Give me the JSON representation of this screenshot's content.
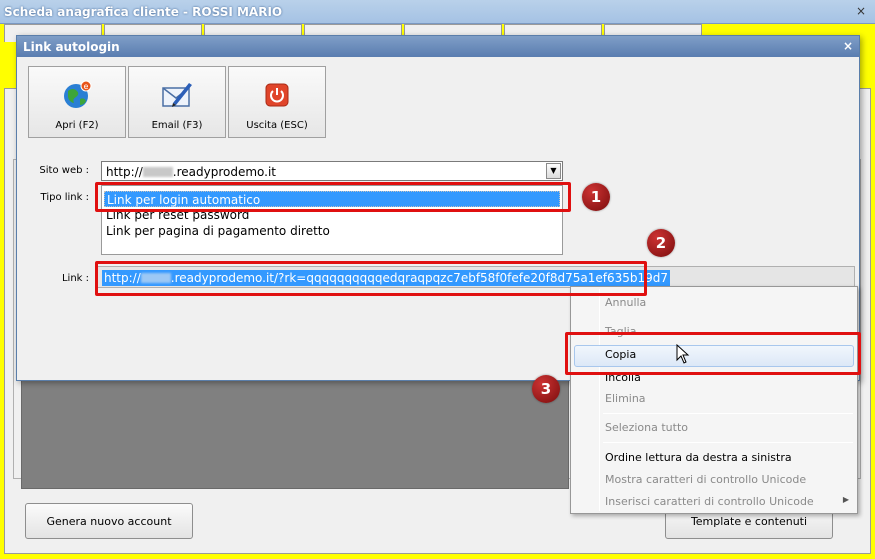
{
  "parent_window": {
    "title": "Scheda anagrafica cliente - ROSSI MARIO",
    "buttons": {
      "new_account": "Genera nuovo account",
      "templates": "Template e contenuti"
    }
  },
  "dialog": {
    "title": "Link autologin",
    "close": "×",
    "toolbar": {
      "open": "Apri (F2)",
      "email": "Email (F3)",
      "exit": "Uscita (ESC)"
    },
    "website": {
      "label": "Sito web :",
      "value_prefix": "http://",
      "value_suffix": ".readyprodemo.it",
      "dropdown_arrow": "▼"
    },
    "link_type": {
      "label": "Tipo link :",
      "options": [
        "Link per login automatico",
        "Link per reset password",
        "Link per pagina di pagamento diretto"
      ],
      "selected_index": 0
    },
    "link": {
      "label": "Link :",
      "value_prefix": "http://",
      "value_suffix": ".readyprodemo.it/?rk=qqqqqqqqqqedqraqpqzc7ebf58f0fefe20f8d75a1ef635b19d7"
    }
  },
  "context_menu": {
    "items": [
      {
        "label": "Annulla",
        "enabled": false
      },
      {
        "label": "Taglia",
        "enabled": false
      },
      {
        "label": "Copia",
        "enabled": true,
        "hover": true
      },
      {
        "label": "Incolla",
        "enabled": true
      },
      {
        "label": "Elimina",
        "enabled": false
      },
      {
        "label": "Seleziona tutto",
        "enabled": false
      },
      {
        "label": "Ordine lettura da destra a sinistra",
        "enabled": true
      },
      {
        "label": "Mostra caratteri di controllo Unicode",
        "enabled": false
      },
      {
        "label": "Inserisci caratteri di controllo Unicode",
        "enabled": false,
        "submenu": true
      }
    ],
    "submenu_arrow": "▶"
  },
  "annotations": {
    "step1": "1",
    "step2": "2",
    "step3": "3",
    "highlight_color": "#e01010",
    "badge_color": "#8b1010"
  },
  "colors": {
    "selection": "#3399ff",
    "background": "#ffff00",
    "dialog_title": "#5a7db0"
  },
  "icons": {
    "open": "globe-icon",
    "email": "envelope-pen-icon",
    "exit": "power-icon"
  }
}
